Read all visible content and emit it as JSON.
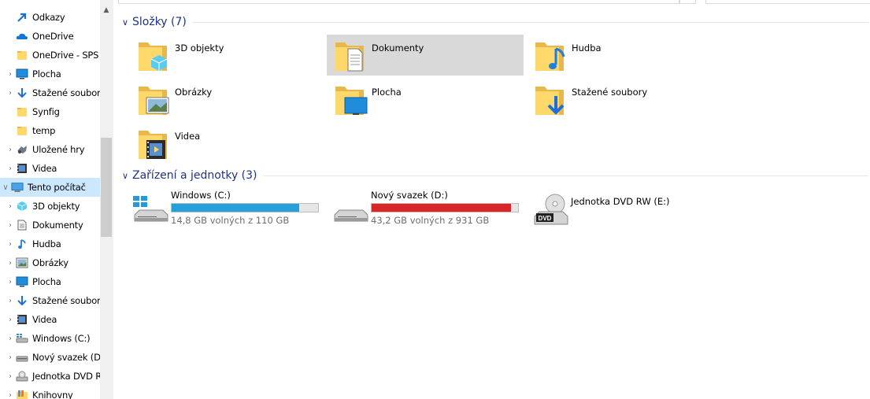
{
  "nav": {
    "items": [
      {
        "label": "Odkazy",
        "icon": "link-folder-icon",
        "expand": false
      },
      {
        "label": "OneDrive",
        "icon": "onedrive-cloud-icon",
        "expand": false
      },
      {
        "label": "OneDrive - SPS",
        "icon": "folder-icon",
        "expand": false
      },
      {
        "label": "Plocha",
        "icon": "desktop-icon",
        "expand": true
      },
      {
        "label": "Stažené soubory",
        "icon": "download-icon",
        "expand": true
      },
      {
        "label": "Synfig",
        "icon": "folder-icon",
        "expand": false
      },
      {
        "label": "temp",
        "icon": "folder-icon",
        "expand": false
      },
      {
        "label": "Uložené hry",
        "icon": "saved-games-icon",
        "expand": true
      },
      {
        "label": "Videa",
        "icon": "video-icon",
        "expand": true
      },
      {
        "label": "Tento počítač",
        "icon": "computer-icon",
        "expand": true,
        "expanded": true,
        "selected": true
      },
      {
        "label": "3D objekty",
        "icon": "objects-3d-icon",
        "expand": true
      },
      {
        "label": "Dokumenty",
        "icon": "document-icon",
        "expand": true
      },
      {
        "label": "Hudba",
        "icon": "music-icon",
        "expand": true
      },
      {
        "label": "Obrázky",
        "icon": "pictures-icon",
        "expand": true
      },
      {
        "label": "Plocha",
        "icon": "desktop-icon",
        "expand": true
      },
      {
        "label": "Stažené soubory",
        "icon": "download-icon",
        "expand": true
      },
      {
        "label": "Videa",
        "icon": "video-icon",
        "expand": true
      },
      {
        "label": "Windows (C:)",
        "icon": "windows-drive-icon",
        "expand": true
      },
      {
        "label": "Nový svazek (D:)",
        "icon": "drive-icon",
        "expand": true
      },
      {
        "label": "Jednotka DVD RW (E:)",
        "icon": "dvd-drive-icon",
        "expand": true
      },
      {
        "label": "Knihovny",
        "icon": "libraries-icon",
        "expand": true
      }
    ]
  },
  "folders_section": {
    "title": "Složky (7)"
  },
  "folders": [
    {
      "label": "3D objekty",
      "icon": "objects-3d-folder-icon"
    },
    {
      "label": "Dokumenty",
      "icon": "documents-folder-icon",
      "selected": true
    },
    {
      "label": "Hudba",
      "icon": "music-folder-icon"
    },
    {
      "label": "Obrázky",
      "icon": "pictures-folder-icon"
    },
    {
      "label": "Plocha",
      "icon": "desktop-folder-icon"
    },
    {
      "label": "Stažené soubory",
      "icon": "downloads-folder-icon"
    },
    {
      "label": "Videa",
      "icon": "videos-folder-icon"
    }
  ],
  "devices_section": {
    "title": "Zařízení a jednotky (3)"
  },
  "devices": [
    {
      "label": "Windows (C:)",
      "icon": "windows-drive-icon",
      "free": "14,8 GB volných z 110 GB",
      "used_fraction": 0.87,
      "bar_color": "#26a0da"
    },
    {
      "label": "Nový svazek (D:)",
      "icon": "drive-icon",
      "free": "43,2 GB volných z 931 GB",
      "used_fraction": 0.95,
      "bar_color": "#da2626"
    },
    {
      "label": "Jednotka DVD RW (E:)",
      "icon": "dvd-drive-icon"
    }
  ]
}
